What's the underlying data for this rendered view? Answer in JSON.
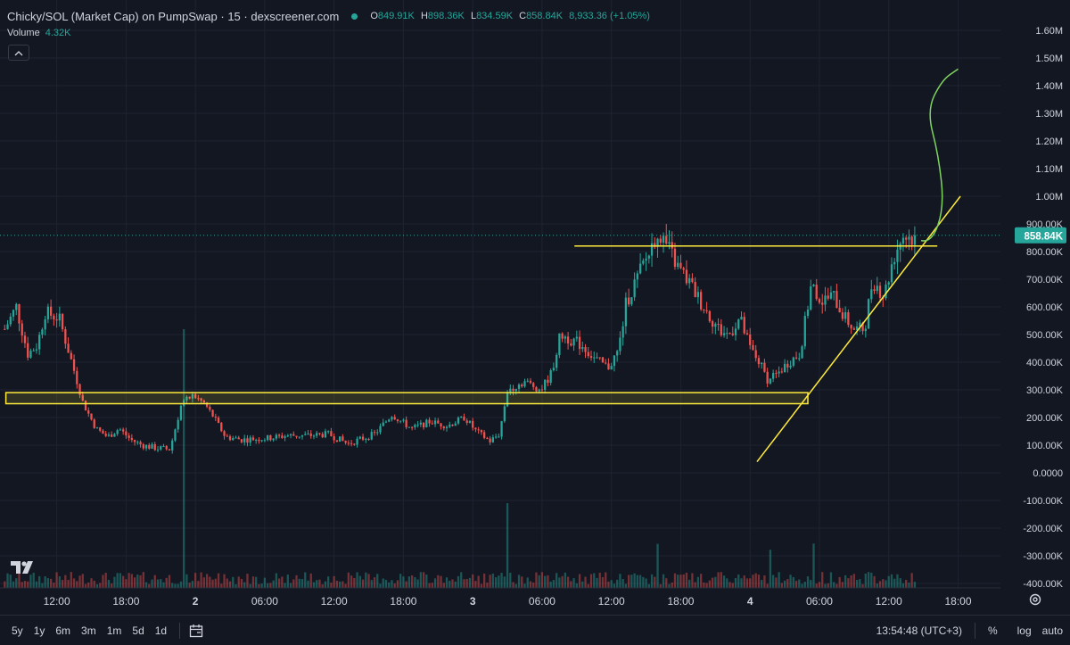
{
  "header": {
    "title": "Chicky/SOL (Market Cap) on PumpSwap · 15 · dexscreener.com",
    "ohlc": {
      "o_label": "O",
      "o": "849.91K",
      "h_label": "H",
      "h": "898.36K",
      "l_label": "L",
      "l": "834.59K",
      "c_label": "C",
      "c": "858.84K",
      "change": "8,933.36 (+1.05%)"
    }
  },
  "volume": {
    "label": "Volume",
    "value": "4.32K"
  },
  "toolbar": {
    "timeframes": [
      "5y",
      "1y",
      "6m",
      "3m",
      "1m",
      "5d",
      "1d"
    ],
    "clock": "13:54:48 (UTC+3)",
    "percent_label": "%",
    "log_label": "log",
    "auto_label": "auto"
  },
  "icons": {
    "collapse": "chevron-up-icon",
    "logo": "tradingview-logo",
    "calendar": "calendar-range-icon",
    "settings": "gear-icon"
  },
  "colors": {
    "background": "#131722",
    "up": "#26a69a",
    "down": "#ef5350",
    "drawing_yellow": "#ffeb3b",
    "drawing_green": "#7fd45f",
    "price_label": "#26a69a"
  },
  "chart_data": {
    "type": "candlestick",
    "title": "Chicky/SOL (Market Cap)",
    "y_unit": "market cap",
    "ylim": [
      -420000,
      1680000
    ],
    "y_ticks": [
      1600000,
      1500000,
      1400000,
      1300000,
      1200000,
      1100000,
      1000000,
      900000,
      800000,
      700000,
      600000,
      500000,
      400000,
      300000,
      200000,
      100000,
      0,
      -100000,
      -200000,
      -300000,
      -400000
    ],
    "y_tick_labels": [
      "1.60M",
      "1.50M",
      "1.40M",
      "1.30M",
      "1.20M",
      "1.10M",
      "1.00M",
      "900.00K",
      "800.00K",
      "700.00K",
      "600.00K",
      "500.00K",
      "400.00K",
      "300.00K",
      "200.00K",
      "100.00K",
      "0.0000",
      "-100.00K",
      "-200.00K",
      "-300.00K",
      "-400.00K"
    ],
    "x_ticks_hours": [
      12,
      18,
      24,
      30,
      36,
      42,
      48,
      54,
      60,
      66,
      72,
      78,
      84,
      90
    ],
    "x_tick_labels": [
      "12:00",
      "18:00",
      "2",
      "06:00",
      "12:00",
      "18:00",
      "3",
      "06:00",
      "12:00",
      "18:00",
      "4",
      "06:00",
      "12:00",
      "18:00"
    ],
    "x_range_hours": [
      7.4,
      92.2
    ],
    "candle_interval_minutes": 15,
    "current_price": 858840,
    "current_price_label": "858.84K",
    "close_path": [
      {
        "t": 7.5,
        "v": 520000
      },
      {
        "t": 8.5,
        "v": 600000
      },
      {
        "t": 9.5,
        "v": 430000
      },
      {
        "t": 10.3,
        "v": 460000
      },
      {
        "t": 11.0,
        "v": 580000
      },
      {
        "t": 12.2,
        "v": 560000
      },
      {
        "t": 13.3,
        "v": 400000
      },
      {
        "t": 14.3,
        "v": 250000
      },
      {
        "t": 15.4,
        "v": 160000
      },
      {
        "t": 16.4,
        "v": 130000
      },
      {
        "t": 17.4,
        "v": 160000
      },
      {
        "t": 18.4,
        "v": 120000
      },
      {
        "t": 19.4,
        "v": 100000
      },
      {
        "t": 20.5,
        "v": 90000
      },
      {
        "t": 21.8,
        "v": 85000
      },
      {
        "t": 22.8,
        "v": 250000
      },
      {
        "t": 23.8,
        "v": 280000
      },
      {
        "t": 24.8,
        "v": 250000
      },
      {
        "t": 25.6,
        "v": 200000
      },
      {
        "t": 26.6,
        "v": 130000
      },
      {
        "t": 28.0,
        "v": 120000
      },
      {
        "t": 30.2,
        "v": 125000
      },
      {
        "t": 32.0,
        "v": 135000
      },
      {
        "t": 33.9,
        "v": 135000
      },
      {
        "t": 35.5,
        "v": 140000
      },
      {
        "t": 37.2,
        "v": 105000
      },
      {
        "t": 39.5,
        "v": 140000
      },
      {
        "t": 41.0,
        "v": 210000
      },
      {
        "t": 42.7,
        "v": 160000
      },
      {
        "t": 44.3,
        "v": 185000
      },
      {
        "t": 45.8,
        "v": 170000
      },
      {
        "t": 47.3,
        "v": 200000
      },
      {
        "t": 48.3,
        "v": 150000
      },
      {
        "t": 49.5,
        "v": 115000
      },
      {
        "t": 50.3,
        "v": 140000
      },
      {
        "t": 51.0,
        "v": 300000
      },
      {
        "t": 52.5,
        "v": 330000
      },
      {
        "t": 53.9,
        "v": 300000
      },
      {
        "t": 54.8,
        "v": 360000
      },
      {
        "t": 55.6,
        "v": 500000
      },
      {
        "t": 56.6,
        "v": 480000
      },
      {
        "t": 57.5,
        "v": 460000
      },
      {
        "t": 58.6,
        "v": 410000
      },
      {
        "t": 59.7,
        "v": 380000
      },
      {
        "t": 60.6,
        "v": 440000
      },
      {
        "t": 61.3,
        "v": 620000
      },
      {
        "t": 62.2,
        "v": 700000
      },
      {
        "t": 63.2,
        "v": 790000
      },
      {
        "t": 64.0,
        "v": 880000
      },
      {
        "t": 64.8,
        "v": 820000
      },
      {
        "t": 65.8,
        "v": 740000
      },
      {
        "t": 66.7,
        "v": 690000
      },
      {
        "t": 67.7,
        "v": 620000
      },
      {
        "t": 68.6,
        "v": 560000
      },
      {
        "t": 69.5,
        "v": 510000
      },
      {
        "t": 70.2,
        "v": 500000
      },
      {
        "t": 71.1,
        "v": 560000
      },
      {
        "t": 72.0,
        "v": 450000
      },
      {
        "t": 72.8,
        "v": 400000
      },
      {
        "t": 73.6,
        "v": 330000
      },
      {
        "t": 74.4,
        "v": 360000
      },
      {
        "t": 75.3,
        "v": 400000
      },
      {
        "t": 76.3,
        "v": 430000
      },
      {
        "t": 77.3,
        "v": 680000
      },
      {
        "t": 78.2,
        "v": 620000
      },
      {
        "t": 79.2,
        "v": 640000
      },
      {
        "t": 80.2,
        "v": 560000
      },
      {
        "t": 81.0,
        "v": 520000
      },
      {
        "t": 81.9,
        "v": 520000
      },
      {
        "t": 82.6,
        "v": 700000
      },
      {
        "t": 83.6,
        "v": 640000
      },
      {
        "t": 84.4,
        "v": 780000
      },
      {
        "t": 85.2,
        "v": 860000
      },
      {
        "t": 85.9,
        "v": 850000
      },
      {
        "t": 86.4,
        "v": 858840
      }
    ],
    "drawings": [
      {
        "type": "rectangle",
        "label": "support zone",
        "t_start": 7.6,
        "t_end": 77.0,
        "v_low": 250000,
        "v_high": 290000
      },
      {
        "type": "horizontal_segment",
        "label": "resistance",
        "t_start": 56.8,
        "t_end": 88.2,
        "v": 820000
      },
      {
        "type": "trendline",
        "label": "ascending trendline",
        "points": [
          {
            "t": 72.6,
            "v": 40000
          },
          {
            "t": 90.2,
            "v": 1000000
          }
        ]
      },
      {
        "type": "freehand_arrow",
        "label": "projected path",
        "color": "green",
        "points": [
          {
            "t": 86.8,
            "v": 840000
          },
          {
            "t": 87.7,
            "v": 830000
          },
          {
            "t": 88.8,
            "v": 960000
          },
          {
            "t": 88.3,
            "v": 1150000
          },
          {
            "t": 87.3,
            "v": 1310000
          },
          {
            "t": 88.6,
            "v": 1420000
          },
          {
            "t": 90.0,
            "v": 1460000
          }
        ]
      }
    ]
  }
}
